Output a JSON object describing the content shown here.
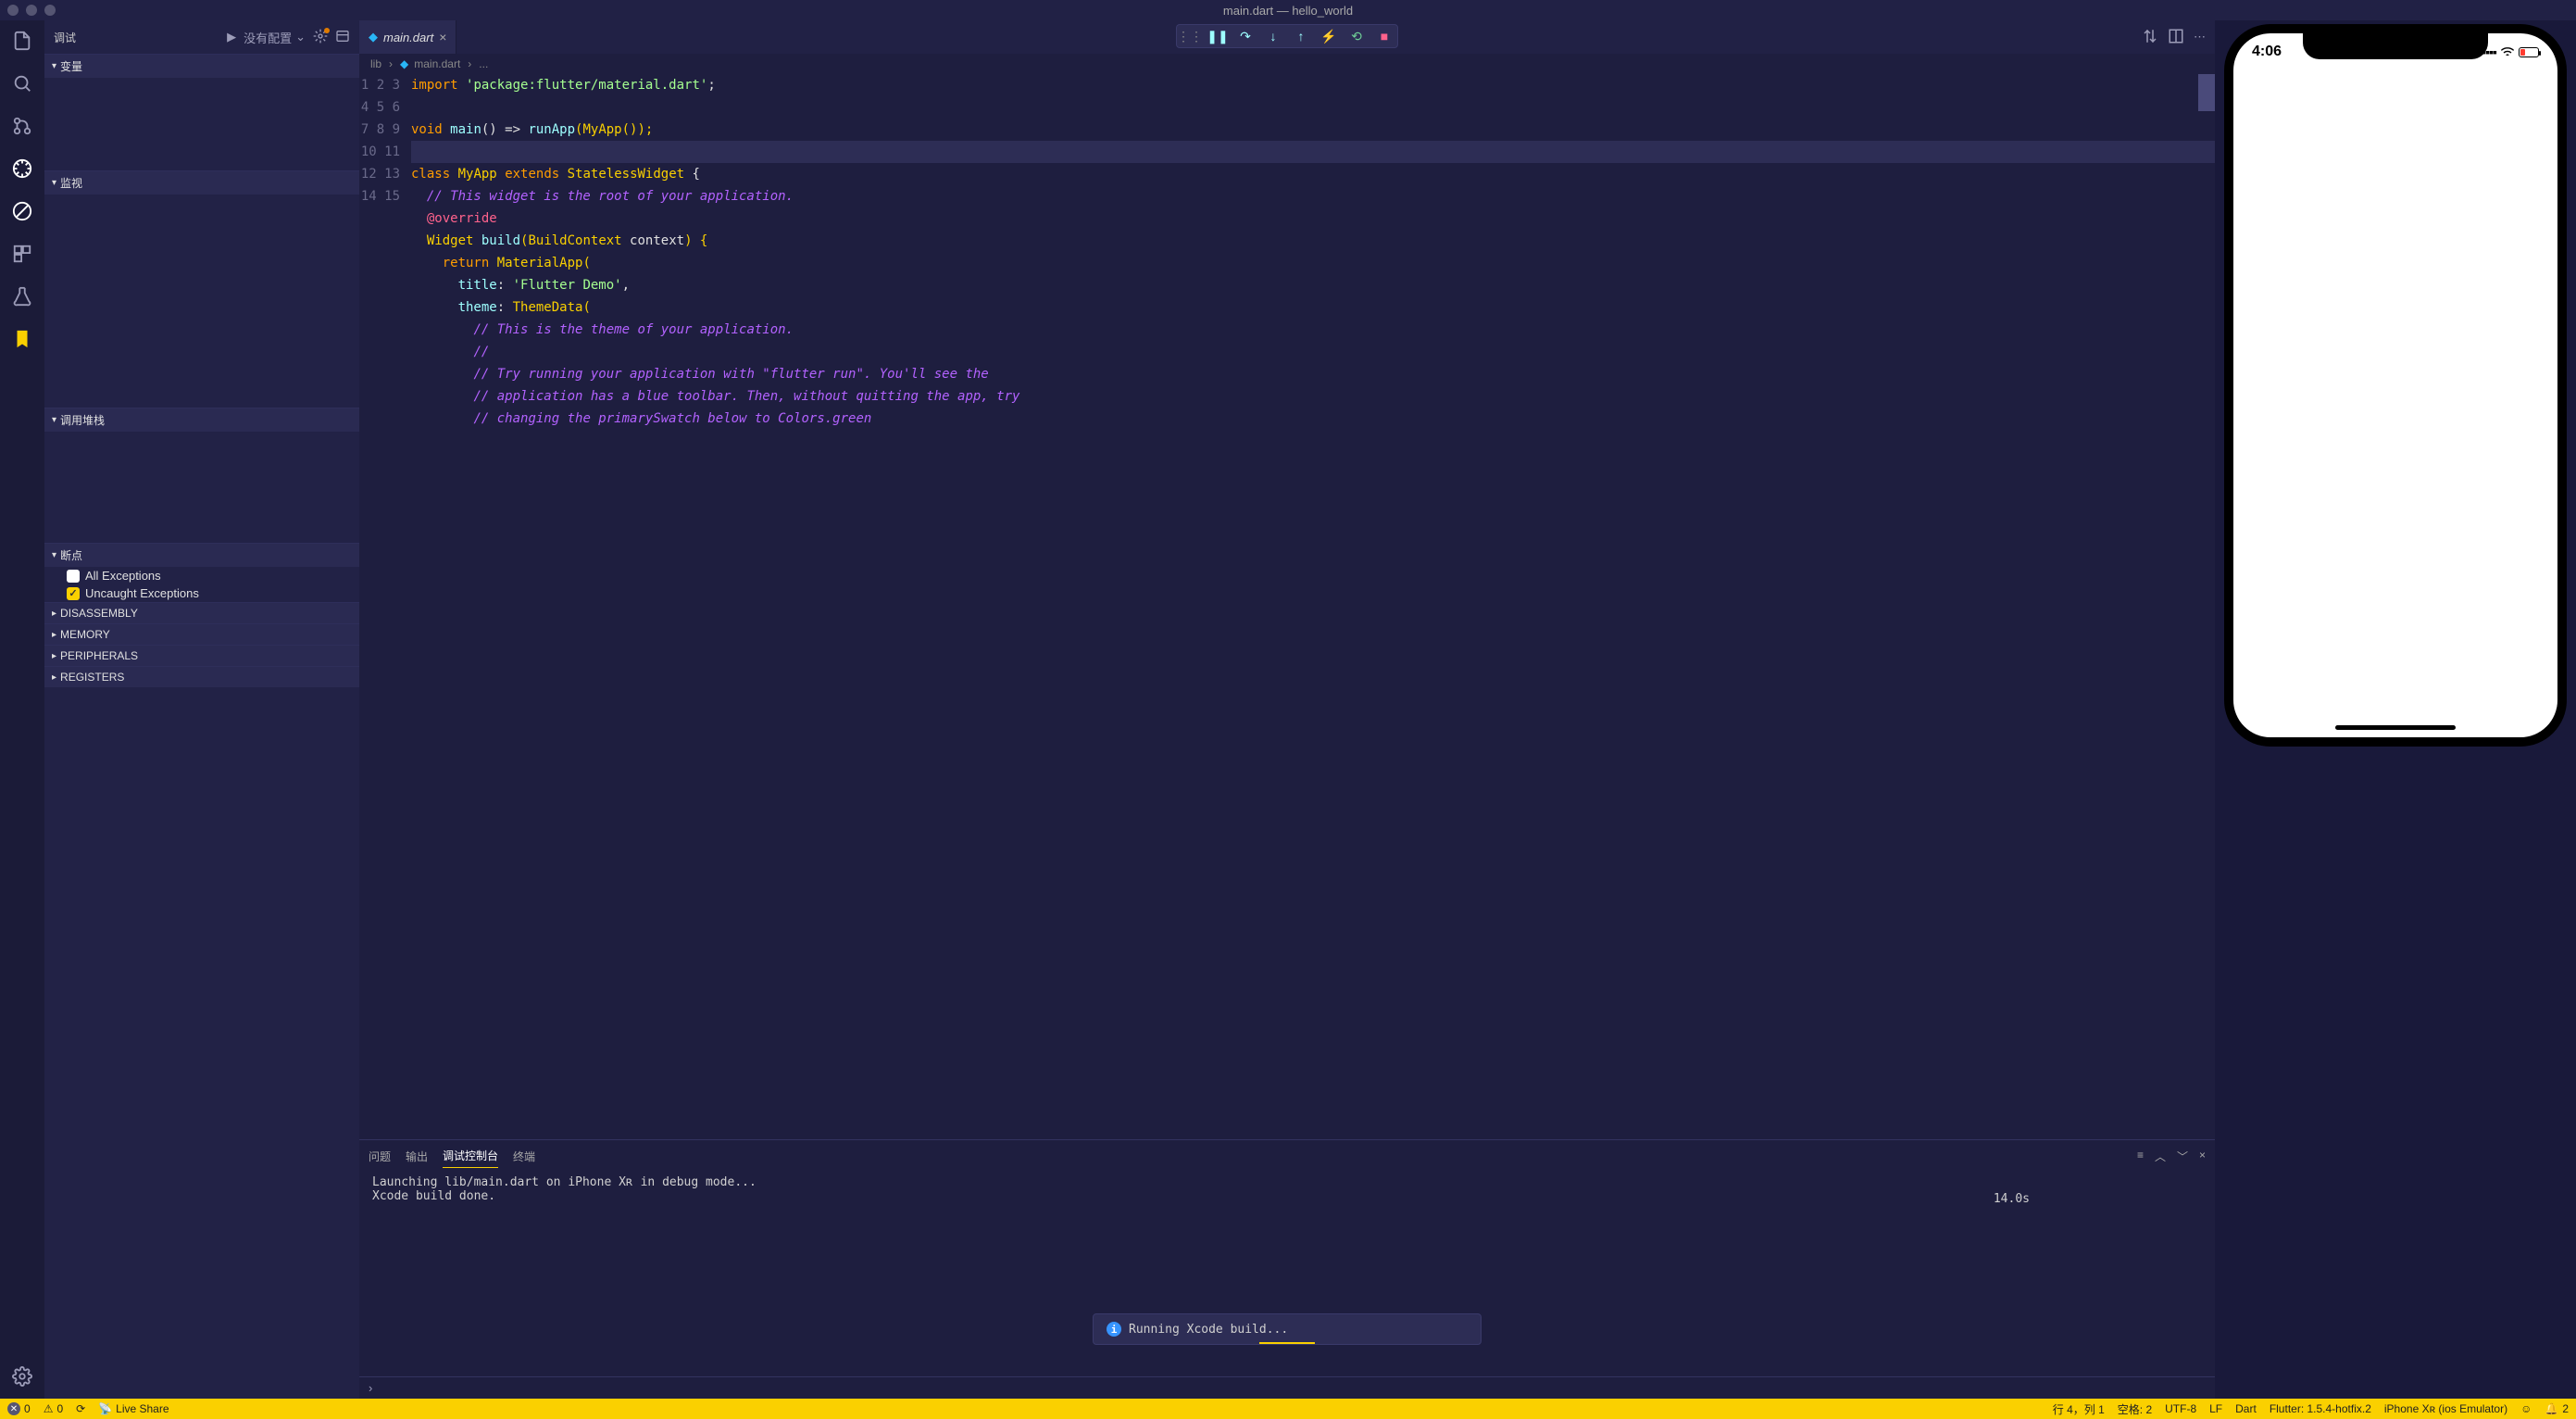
{
  "titlebar": {
    "title": "main.dart — hello_world"
  },
  "sidebar": {
    "title": "调试",
    "configLabel": "没有配置",
    "sections": {
      "variables": "变量",
      "watch": "监视",
      "callstack": "调用堆栈",
      "breakpoints": "断点",
      "disassembly": "DISASSEMBLY",
      "memory": "MEMORY",
      "peripherals": "PERIPHERALS",
      "registers": "REGISTERS"
    },
    "breakpointItems": {
      "allExceptions": "All Exceptions",
      "uncaughtExceptions": "Uncaught Exceptions"
    }
  },
  "tab": {
    "label": "main.dart"
  },
  "breadcrumb": {
    "part0": "lib",
    "part1": "main.dart",
    "part2": "..."
  },
  "code": {
    "line1_import": "import",
    "line1_str": "'package:flutter/material.dart'",
    "line1_end": ";",
    "line3_void": "void",
    "line3_main": "main",
    "line3_arrow": "() => ",
    "line3_runApp": "runApp",
    "line3_open": "(",
    "line3_MyApp": "MyApp",
    "line3_close": "());",
    "line5_class": "class",
    "line5_MyApp": "MyApp",
    "line5_extends": "extends",
    "line5_SW": "StatelessWidget",
    "line5_brace": " {",
    "line6_cmt": "// This widget is the root of your application.",
    "line7_ann": "@override",
    "line8_Widget": "Widget",
    "line8_build": "build",
    "line8_open": "(",
    "line8_BC": "BuildContext",
    "line8_ctx": " context",
    "line8_close": ") {",
    "line9_return": "return",
    "line9_MA": "MaterialApp",
    "line9_open": "(",
    "line10_title": "title",
    "line10_colon": ": ",
    "line10_str": "'Flutter Demo'",
    "line10_comma": ",",
    "line11_theme": "theme",
    "line11_colon": ": ",
    "line11_TD": "ThemeData",
    "line11_open": "(",
    "line12_cmt": "// This is the theme of your application.",
    "line13_cmt": "//",
    "line14_cmt": "// Try running your application with \"flutter run\". You'll see the",
    "line15_cmt": "// application has a blue toolbar. Then, without quitting the app, try",
    "line16_cmt": "// changing the primarySwatch below to Colors.green"
  },
  "lineNumbers": [
    "1",
    "2",
    "3",
    "4",
    "5",
    "6",
    "7",
    "8",
    "9",
    "10",
    "11",
    "12",
    "13",
    "14",
    "15"
  ],
  "panel": {
    "tabs": {
      "problems": "问题",
      "output": "输出",
      "debugConsole": "调试控制台",
      "terminal": "终端"
    },
    "output": {
      "line1": "Launching lib/main.dart on iPhone Xʀ in debug mode...",
      "line2": "Xcode build done.",
      "timing": "14.0s"
    }
  },
  "toast": {
    "message": "Running Xcode build..."
  },
  "statusbar": {
    "errors": "0",
    "warnings": "0",
    "liveShare": "Live Share",
    "cursor": "行 4，列 1",
    "spaces": "空格: 2",
    "encoding": "UTF-8",
    "eol": "LF",
    "language": "Dart",
    "flutter": "Flutter: 1.5.4-hotfix.2",
    "device": "iPhone Xʀ (ios Emulator)",
    "notifications": "2"
  },
  "simulator": {
    "clock": "4:06"
  }
}
